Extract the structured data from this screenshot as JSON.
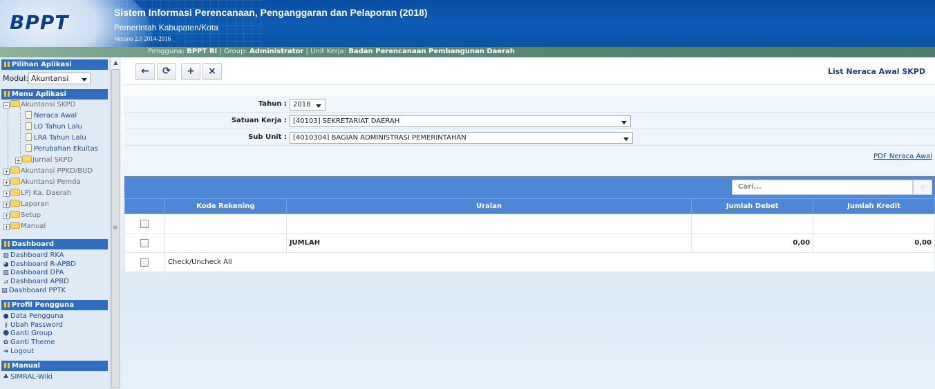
{
  "header": {
    "logo": "BPPT",
    "title": "Sistem Informasi Perencanaan, Penganggaran dan Pelaporan (2018)",
    "subtitle": "Pemerintah Kabupaten/Kota",
    "version": "Version 2.0 2014-2016",
    "user_label": "Pengguna:",
    "user_value": "BPPT RI",
    "group_label": "Group:",
    "group_value": "Administrator",
    "unit_label": "Unit Kerja:",
    "unit_value": "Badan Perencanaan Pembangunan Daerah"
  },
  "sidebar": {
    "pilihan": {
      "title": "Pilihan Aplikasi",
      "modul_label": "Modul:",
      "modul_value": "Akuntansi"
    },
    "menu": {
      "title": "Menu Aplikasi",
      "tree": {
        "akuntansi_skpd": "Akuntansi SKPD",
        "neraca_awal": "Neraca Awal",
        "lo_tahun_lalu": "LO Tahun Lalu",
        "lra_tahun_lalu": "LRA Tahun Lalu",
        "perubahan_ekuitas": "Perubahan Ekuitas",
        "jurnal_skpd": "Jurnal SKPD",
        "akuntansi_ppkd": "Akuntansi PPKD/BUD",
        "akuntansi_pemda": "Akuntansi Pemda",
        "lpj": "LPJ Ka. Daerah",
        "laporan": "Laporan",
        "setup": "Setup",
        "manual": "Manual"
      }
    },
    "dashboard": {
      "title": "Dashboard",
      "items": [
        "Dashboard RKA",
        "Dashboard R-APBD",
        "Dashboard DPA",
        "Dashboard APBD",
        "Dashboard PPTK"
      ]
    },
    "profil": {
      "title": "Profil Pengguna",
      "items": [
        "Data Pengguna",
        "Ubah Password",
        "Ganti Group",
        "Ganti Theme",
        "Logout"
      ]
    },
    "manual": {
      "title": "Manual",
      "items": [
        "SIMRAL-Wiki"
      ]
    }
  },
  "toolbar": {
    "back_icon": "←",
    "refresh_icon": "⟳",
    "add_icon": "+",
    "delete_icon": "×",
    "list_title": "List Neraca Awal SKPD"
  },
  "form": {
    "tahun_label": "Tahun :",
    "tahun_value": "2018",
    "satker_label": "Satuan Kerja :",
    "satker_value": "[40103] SEKRETARIAT DAERAH",
    "subunit_label": "Sub Unit :",
    "subunit_value": "[4010304] BAGIAN ADMINISTRASI PEMERINTAHAN",
    "pdf_link": "PDF Neraca Awal"
  },
  "grid": {
    "search_placeholder": "Cari...",
    "columns": [
      "Kode Rekening",
      "Uraian",
      "Jumlah Debet",
      "Jumlah Kredit"
    ],
    "total_label": "JUMLAH",
    "total_debet": "0,00",
    "total_kredit": "0,00",
    "check_all": "Check/Uncheck All"
  }
}
